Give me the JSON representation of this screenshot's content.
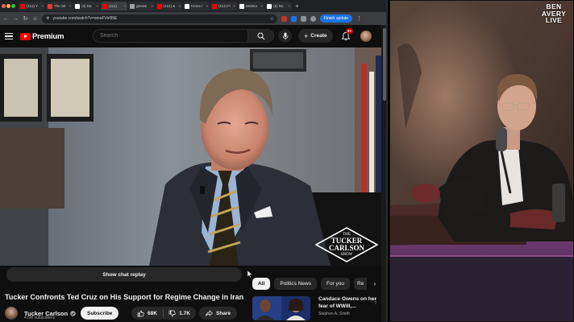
{
  "browser": {
    "tabs": [
      {
        "label": "(111) Y",
        "favicon_color": "#ff0000"
      },
      {
        "label": "The Sh",
        "favicon_color": "#e53935"
      },
      {
        "label": "(4) Da",
        "favicon_color": "#ffffff"
      },
      {
        "label": "(111) ",
        "favicon_color": "#ff0000"
      },
      {
        "label": "genesi",
        "favicon_color": "#9aa0a6"
      },
      {
        "label": "(111) w",
        "favicon_color": "#ff0000"
      },
      {
        "label": "Home /",
        "favicon_color": "#ffffff"
      },
      {
        "label": "(111) Fi",
        "favicon_color": "#ff0000"
      },
      {
        "label": "WebEx",
        "favicon_color": "#ffffff"
      },
      {
        "label": "(2) No",
        "favicon_color": "#ffffff"
      }
    ],
    "new_tab_icon": "plus-icon",
    "url": "youtube.com/watch?v=omeFVe0l5E",
    "finish_update": "Finish update"
  },
  "youtube": {
    "logo_text": "Premium",
    "search_placeholder": "Search",
    "create_label": "Create",
    "notification_count": "9+",
    "show_chat_replay": "Show chat replay",
    "chips": [
      "All",
      "Politics News",
      "For you",
      "Re"
    ],
    "video_title": "Tucker Confronts Ted Cruz on His Support for Regime Change in Iran",
    "channel_name": "Tucker Carlson",
    "subscriber_count": "4.5M subscribers",
    "subscribe_label": "Subscribe",
    "likes": "68K",
    "dislikes": "1.7K",
    "share_label": "Share",
    "video_watermark_line1": "THE",
    "video_watermark_line2": "TUCKER",
    "video_watermark_line3": "CARLSON",
    "video_watermark_line4": "SHOW",
    "recommended": {
      "title": "Candace Owens on her fear of WWIII,...",
      "channel": "Stephen A. Smith"
    }
  },
  "overlay_logo": {
    "line1": "BEN",
    "line2": "AVERY",
    "line3": "LIVE"
  },
  "colors": {
    "youtube_red": "#ff0000",
    "update_blue": "#1a73e8",
    "dark_bg": "#0f0f0f"
  }
}
